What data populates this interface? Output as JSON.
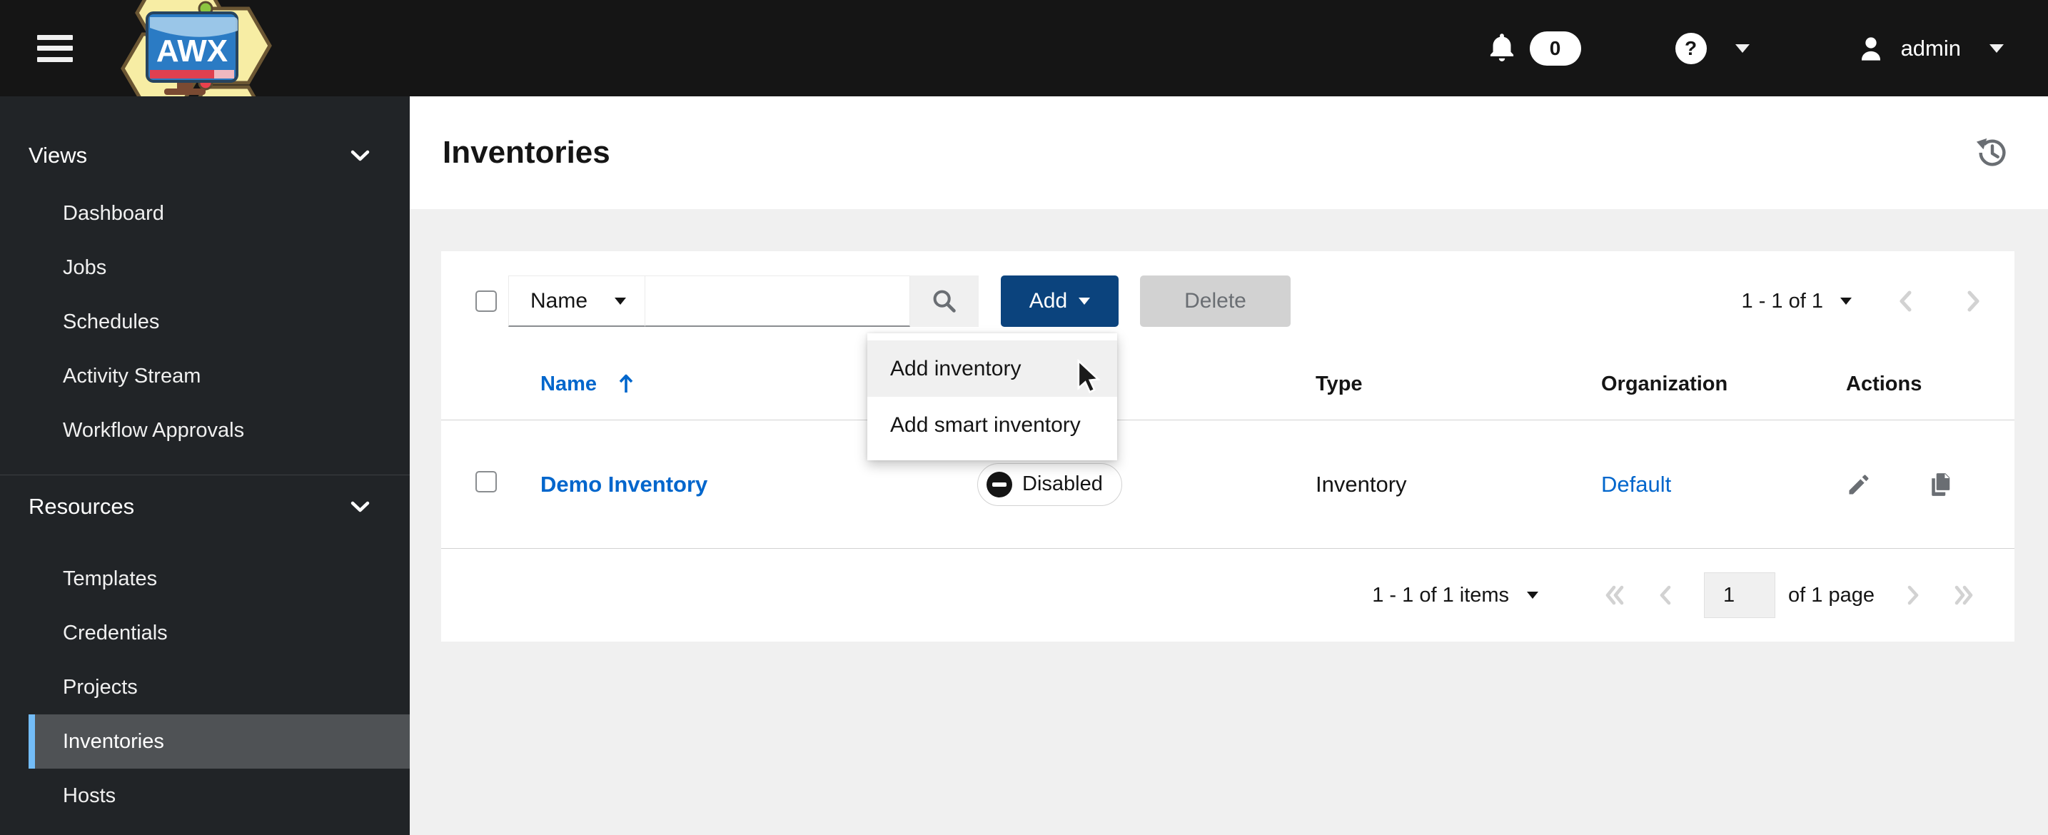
{
  "topbar": {
    "badge_count": "0",
    "help_glyph": "?",
    "username": "admin"
  },
  "sidebar": {
    "groups": [
      {
        "label": "Views",
        "items": [
          "Dashboard",
          "Jobs",
          "Schedules",
          "Activity Stream",
          "Workflow Approvals"
        ]
      },
      {
        "label": "Resources",
        "items": [
          "Templates",
          "Credentials",
          "Projects",
          "Inventories",
          "Hosts"
        ],
        "selected": "Inventories"
      }
    ]
  },
  "page": {
    "title": "Inventories"
  },
  "toolbar": {
    "filter_label": "Name",
    "search_value": "",
    "add_label": "Add",
    "delete_label": "Delete",
    "range": "1 - 1 of 1"
  },
  "dropdown": {
    "items": [
      "Add inventory",
      "Add smart inventory"
    ]
  },
  "table": {
    "headers": [
      "Name",
      "Type",
      "Organization",
      "Actions"
    ],
    "rows": [
      {
        "name": "Demo Inventory",
        "status": "Disabled",
        "type": "Inventory",
        "organization": "Default"
      }
    ]
  },
  "footer": {
    "items_label": "1 - 1 of 1 items",
    "page_value": "1",
    "page_label": "of 1 page"
  },
  "colors": {
    "link_blue": "#0066cc",
    "primary_button": "#0b437d",
    "selected_nav_border": "#73bcf7",
    "masthead": "#151515",
    "sidebar_bg": "#212427"
  }
}
